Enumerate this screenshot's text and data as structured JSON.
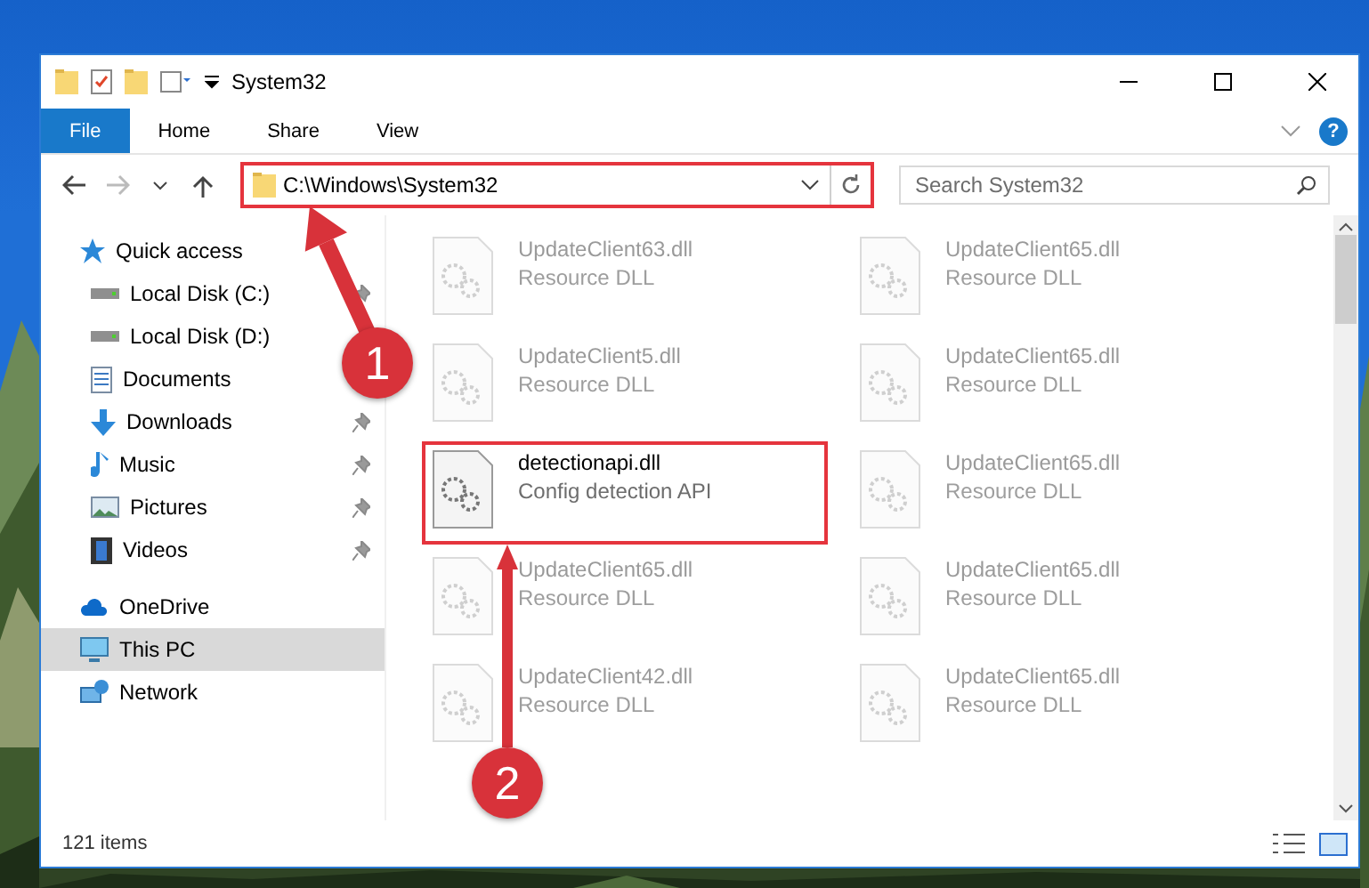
{
  "window": {
    "title": "System32"
  },
  "ribbon": {
    "tabs": [
      {
        "label": "File",
        "kind": "file"
      },
      {
        "label": "Home",
        "kind": "tab"
      },
      {
        "label": "Share",
        "kind": "tab"
      },
      {
        "label": "View",
        "kind": "tab"
      }
    ],
    "help": "?"
  },
  "address": {
    "path": "C:\\Windows\\System32",
    "highlighted": true
  },
  "search": {
    "placeholder": "Search System32"
  },
  "navigation": {
    "items": [
      {
        "label": "Quick access",
        "kind": "star",
        "selected": false,
        "children": [
          {
            "label": "Local Disk (C:)",
            "kind": "drive",
            "pinned": true,
            "selected": false
          },
          {
            "label": "Local Disk (D:)",
            "kind": "drive",
            "selected": false
          },
          {
            "label": "Documents",
            "kind": "document",
            "selected": false
          },
          {
            "label": "Downloads",
            "kind": "download",
            "pinned": true,
            "selected": false
          },
          {
            "label": "Music",
            "kind": "music",
            "pinned": true,
            "selected": false
          },
          {
            "label": "Pictures",
            "kind": "pictures",
            "pinned": true,
            "selected": false
          },
          {
            "label": "Videos",
            "kind": "videos",
            "pinned": true,
            "selected": false
          }
        ]
      },
      {
        "label": "OneDrive",
        "kind": "cloud",
        "selected": false
      },
      {
        "label": "This PC",
        "kind": "pc",
        "selected": true
      },
      {
        "label": "Network",
        "kind": "network",
        "selected": false
      }
    ]
  },
  "files": [
    {
      "name": "UpdateClient63.dll",
      "description": "Resource DLL",
      "blurred": true,
      "highlighted": false
    },
    {
      "name": "UpdateClient65.dll",
      "description": "Resource DLL",
      "blurred": true,
      "highlighted": false
    },
    {
      "name": "UpdateClient5.dll",
      "description": "Resource DLL",
      "blurred": true,
      "highlighted": false
    },
    {
      "name": "UpdateClient65.dll",
      "description": "Resource DLL",
      "blurred": true,
      "highlighted": false
    },
    {
      "name": "detectionapi.dll",
      "description": "Config detection API",
      "blurred": false,
      "highlighted": true
    },
    {
      "name": "UpdateClient65.dll",
      "description": "Resource DLL",
      "blurred": true,
      "highlighted": false
    },
    {
      "name": "UpdateClient65.dll",
      "description": "Resource DLL",
      "blurred": true,
      "highlighted": false
    },
    {
      "name": "UpdateClient65.dll",
      "description": "Resource DLL",
      "blurred": true,
      "highlighted": false
    },
    {
      "name": "UpdateClient42.dll",
      "description": "Resource DLL",
      "blurred": true,
      "highlighted": false
    },
    {
      "name": "UpdateClient65.dll",
      "description": "Resource DLL",
      "blurred": true,
      "highlighted": false
    }
  ],
  "annotations": [
    {
      "label": "1"
    },
    {
      "label": "2"
    }
  ],
  "status_bar": {
    "item_count": "121 items"
  }
}
